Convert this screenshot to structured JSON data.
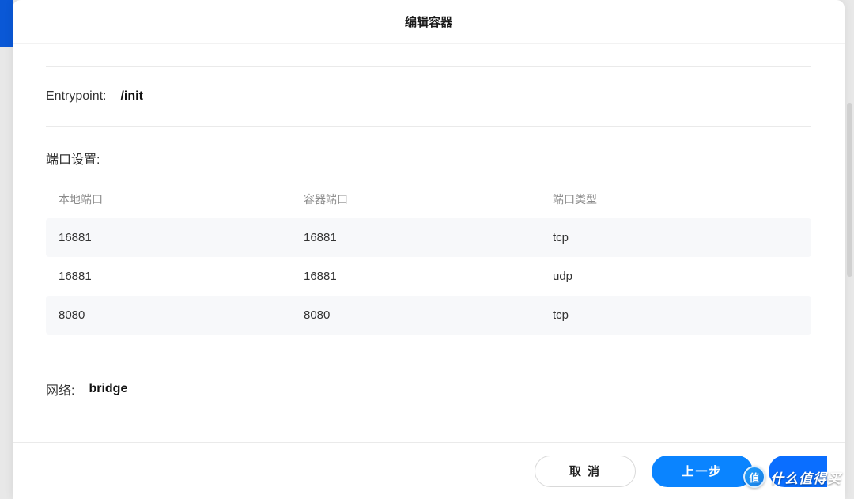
{
  "header": {
    "title": "编辑容器"
  },
  "entrypoint": {
    "label": "Entrypoint:",
    "value": "/init"
  },
  "ports_section": {
    "title": "端口设置:",
    "headers": {
      "local": "本地端口",
      "container": "容器端口",
      "type": "端口类型"
    },
    "rows": [
      {
        "local": "16881",
        "container": "16881",
        "type": "tcp"
      },
      {
        "local": "16881",
        "container": "16881",
        "type": "udp"
      },
      {
        "local": "8080",
        "container": "8080",
        "type": "tcp"
      }
    ]
  },
  "network": {
    "label": "网络:",
    "value": "bridge"
  },
  "footer": {
    "cancel": "取 消",
    "prev": "上一步"
  },
  "watermark": {
    "badge": "值",
    "text": "什么值得买"
  }
}
